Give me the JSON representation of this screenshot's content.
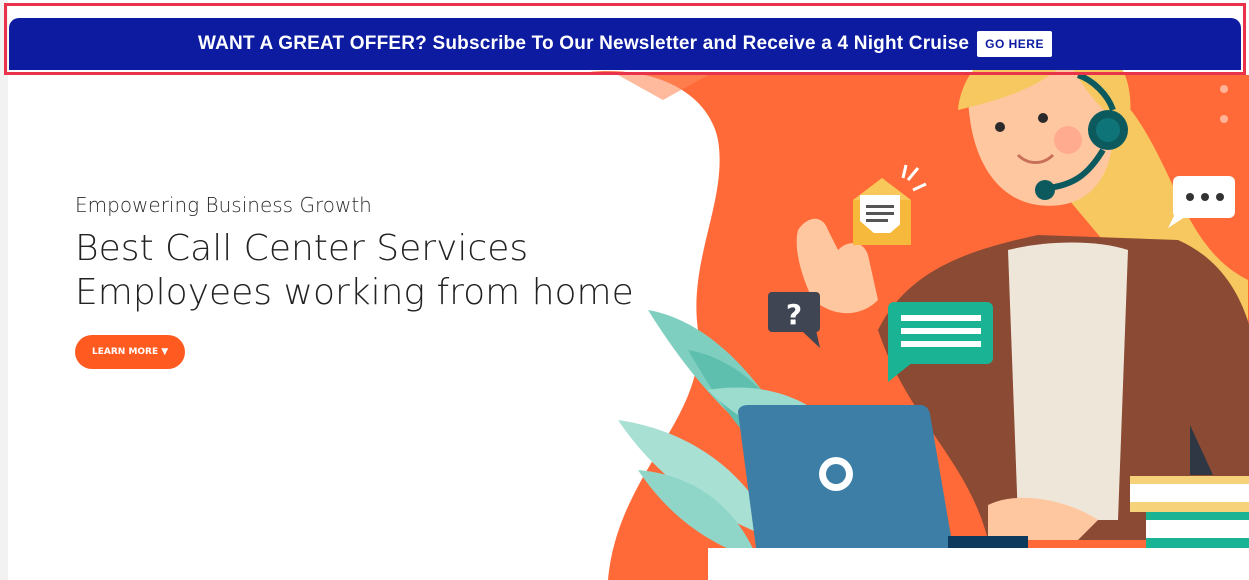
{
  "announcement": {
    "text": "WANT A GREAT OFFER? Subscribe To Our Newsletter and Receive a 4 Night Cruise",
    "button_label": "GO HERE",
    "bar_color": "#0c1ba0",
    "highlight_color": "#e8334a"
  },
  "hero": {
    "subtitle": "Empowering Business Growth",
    "title_line1": "Best Call Center Services",
    "title_line2": "Employees working from home",
    "button_label": "LEARN MORE",
    "button_icon": "chevron-down-icon",
    "accent_color": "#ff5a1f"
  },
  "illustration": {
    "icons": [
      "question-mark-bubble-icon",
      "envelope-icon",
      "chat-bubble-icon",
      "ellipsis-bubble-icon",
      "headset-icon",
      "laptop-icon"
    ],
    "question_glyph": "?"
  }
}
